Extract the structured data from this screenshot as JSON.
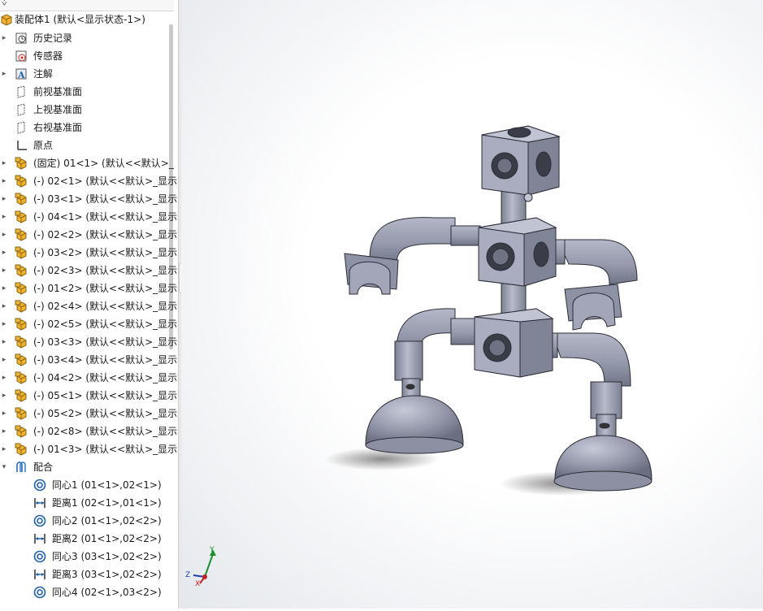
{
  "tree": {
    "filter_icon": "filter-icon",
    "root": {
      "label": "装配体1  (默认<显示状态-1>)",
      "icon": "assembly-icon"
    },
    "items": [
      {
        "label": "历史记录",
        "icon": "history-icon",
        "expander": "▸"
      },
      {
        "label": "传感器",
        "icon": "sensor-icon",
        "expander": ""
      },
      {
        "label": "注解",
        "icon": "annotation-icon",
        "expander": "▸"
      },
      {
        "label": "前视基准面",
        "icon": "plane-icon",
        "expander": ""
      },
      {
        "label": "上视基准面",
        "icon": "plane-icon",
        "expander": ""
      },
      {
        "label": "右视基准面",
        "icon": "plane-icon",
        "expander": ""
      },
      {
        "label": "原点",
        "icon": "origin-icon",
        "expander": ""
      },
      {
        "label": "(固定) 01<1> (默认<<默认>_",
        "icon": "part-icon",
        "expander": "▸"
      },
      {
        "label": "(-) 02<1> (默认<<默认>_显示",
        "icon": "part-icon",
        "expander": "▸"
      },
      {
        "label": "(-) 03<1> (默认<<默认>_显示",
        "icon": "part-icon",
        "expander": "▸"
      },
      {
        "label": "(-) 04<1> (默认<<默认>_显示",
        "icon": "part-icon",
        "expander": "▸"
      },
      {
        "label": "(-) 02<2> (默认<<默认>_显示",
        "icon": "part-icon",
        "expander": "▸"
      },
      {
        "label": "(-) 03<2> (默认<<默认>_显示",
        "icon": "part-icon",
        "expander": "▸"
      },
      {
        "label": "(-) 02<3> (默认<<默认>_显示",
        "icon": "part-icon",
        "expander": "▸"
      },
      {
        "label": "(-) 01<2> (默认<<默认>_显示",
        "icon": "part-icon",
        "expander": "▸"
      },
      {
        "label": "(-) 02<4> (默认<<默认>_显示",
        "icon": "part-icon",
        "expander": "▸"
      },
      {
        "label": "(-) 02<5> (默认<<默认>_显示",
        "icon": "part-icon",
        "expander": "▸"
      },
      {
        "label": "(-) 03<3> (默认<<默认>_显示",
        "icon": "part-icon",
        "expander": "▸"
      },
      {
        "label": "(-) 03<4> (默认<<默认>_显示",
        "icon": "part-icon",
        "expander": "▸"
      },
      {
        "label": "(-) 04<2> (默认<<默认>_显示",
        "icon": "part-icon",
        "expander": "▸"
      },
      {
        "label": "(-) 05<1> (默认<<默认>_显示",
        "icon": "part-icon",
        "expander": "▸"
      },
      {
        "label": "(-) 05<2> (默认<<默认>_显示",
        "icon": "part-icon",
        "expander": "▸"
      },
      {
        "label": "(-) 02<8> (默认<<默认>_显示",
        "icon": "part-icon",
        "expander": "▸"
      },
      {
        "label": "(-) 01<3> (默认<<默认>_显示",
        "icon": "part-icon",
        "expander": "▸"
      },
      {
        "label": "配合",
        "icon": "mates-folder-icon",
        "expander": "▾"
      },
      {
        "label": "同心1 (01<1>,02<1>)",
        "icon": "concentric-mate-icon",
        "expander": ""
      },
      {
        "label": "距离1 (02<1>,01<1>)",
        "icon": "distance-mate-icon",
        "expander": ""
      },
      {
        "label": "同心2 (01<1>,02<2>)",
        "icon": "concentric-mate-icon",
        "expander": ""
      },
      {
        "label": "距离2 (01<1>,02<2>)",
        "icon": "distance-mate-icon",
        "expander": ""
      },
      {
        "label": "同心3 (03<1>,02<2>)",
        "icon": "concentric-mate-icon",
        "expander": ""
      },
      {
        "label": "距离3 (03<1>,02<2>)",
        "icon": "distance-mate-icon",
        "expander": ""
      },
      {
        "label": "同心4 (02<1>,03<2>)",
        "icon": "concentric-mate-icon",
        "expander": ""
      }
    ]
  },
  "triad": {
    "x": "X",
    "y": "Y",
    "z": "Z"
  },
  "colors": {
    "part": "#9da2b4",
    "part_dark": "#6e7386",
    "assembly": "#f2b430",
    "mate": "#1f5fa8"
  }
}
